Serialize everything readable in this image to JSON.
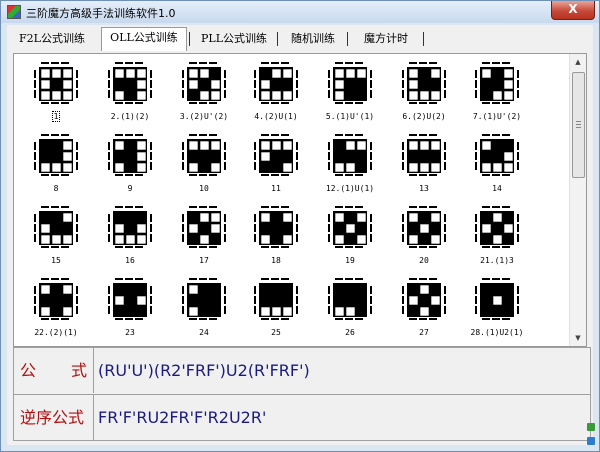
{
  "window": {
    "title": "三阶魔方高级手法训练软件1.0",
    "close_glyph": "X"
  },
  "tabs": [
    {
      "label": "F2L公式训练",
      "active": false
    },
    {
      "label": "OLL公式训练",
      "active": true
    },
    {
      "label": "PLL公式训练",
      "active": false
    },
    {
      "label": "随机训练",
      "active": false
    },
    {
      "label": "魔方计时",
      "active": false
    }
  ],
  "cases": [
    {
      "label": "1",
      "focus": true
    },
    {
      "label": "2.(1)(2)"
    },
    {
      "label": "3.(2)U'(2)"
    },
    {
      "label": "4.(2)U(1)"
    },
    {
      "label": "5.(1)U'(1)"
    },
    {
      "label": "6.(2)U(2)"
    },
    {
      "label": "7.(1)U'(2)"
    },
    {
      "label": "8"
    },
    {
      "label": "9"
    },
    {
      "label": "10"
    },
    {
      "label": "11"
    },
    {
      "label": "12.(1)U(1)"
    },
    {
      "label": "13"
    },
    {
      "label": "14"
    },
    {
      "label": "15"
    },
    {
      "label": "16"
    },
    {
      "label": "17"
    },
    {
      "label": "18"
    },
    {
      "label": "19"
    },
    {
      "label": "20"
    },
    {
      "label": "21.(1)3"
    },
    {
      "label": "22.(2)(1)"
    },
    {
      "label": "23"
    },
    {
      "label": "24"
    },
    {
      "label": "25"
    },
    {
      "label": "26"
    },
    {
      "label": "27"
    },
    {
      "label": "28.(1)U2(1)"
    }
  ],
  "formula": {
    "label_chars": [
      "公",
      "式"
    ],
    "value": "(RU'U')(R2'FRF')U2(R'FRF')"
  },
  "reverse": {
    "label": "逆序公式",
    "value": "FR'F'RU2FR'F'R2U2R'"
  }
}
